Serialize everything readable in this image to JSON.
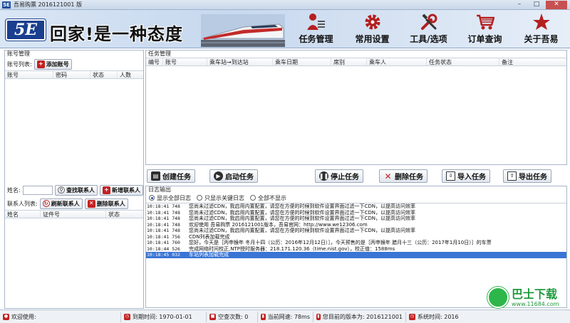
{
  "window": {
    "title": "吾易购票 2016121001 版",
    "app_icon": "5E"
  },
  "banner": {
    "logo": "5E",
    "slogan": "回家!是一种态度"
  },
  "toolbar": [
    {
      "label": "任务管理",
      "icon": "person-list-icon"
    },
    {
      "label": "常用设置",
      "icon": "gear-icon"
    },
    {
      "label": "工具/选项",
      "icon": "wrench-icon"
    },
    {
      "label": "订单查询",
      "icon": "cart-icon"
    },
    {
      "label": "关于吾易",
      "icon": "star-icon"
    }
  ],
  "account": {
    "group_title": "账号管理",
    "list_label": "账号列表:",
    "add_button": "添加账号",
    "columns": [
      "账号",
      "密码",
      "状态",
      "人数"
    ]
  },
  "contacts": {
    "name_label": "姓名:",
    "find_button": "查找联系人",
    "new_button": "新增联系人",
    "list_label": "联系人列表:",
    "refresh_button": "刷新联系人",
    "delete_button": "删除联系人",
    "columns": [
      "姓名",
      "证件号",
      "状态"
    ]
  },
  "tasks": {
    "group_title": "任务管理",
    "columns": [
      "编号",
      "账号",
      "乘车站→到达站",
      "乘车日期",
      "席别",
      "乘车人",
      "任务状态",
      "备注"
    ]
  },
  "actions": {
    "create": "创建任务",
    "start": "启动任务",
    "stop": "停止任务",
    "delete": "删除任务",
    "import": "导入任务",
    "export": "导出任务"
  },
  "log": {
    "group_title": "日志输出",
    "radio_all": "显示全部日志",
    "radio_key": "只显示关键日志",
    "radio_none": "全部不显示",
    "lines": [
      {
        "time": "10:18:41 748",
        "msg": "您尚未过滤CDN，我启用内置配置，请您在方便的时候到软件设置界面过滤一下CDN，以提高访问效率"
      },
      {
        "time": "10:18:41 748",
        "msg": "您尚未过滤CDN，我启用内置配置，请您在方便的时候到软件设置界面过滤一下CDN，以提高访问效率"
      },
      {
        "time": "10:18:41 748",
        "msg": "您尚未过滤CDN，我启用内置配置，请您在方便的时候到软件设置界面过滤一下CDN，以提高访问效率"
      },
      {
        "time": "10:18:41 748",
        "msg": "欢迎使用 吾易购票 2016121001版本，吾易官网：http://www.we12306.com"
      },
      {
        "time": "10:18:41 748",
        "msg": "您尚未过滤CDN，我启用内置配置，请您在方便的时候到软件设置界面过滤一下CDN，以提高访问效率"
      },
      {
        "time": "10:18:41 756",
        "msg": "CDN列表加载完成"
      },
      {
        "time": "10:18:41 760",
        "msg": "您好，今天是［丙申猴年 冬月十四（公历：2016年12月12日）］，今天预售的是［丙申猴年 腊月十三（公历：2017年1月10日）］的车票"
      },
      {
        "time": "10:18:44 526",
        "msg": "完成网络时间校正,NTP授时服务器：218.171.120.36（time.nist.gov），校正值：1588ms"
      },
      {
        "time": "10:18:45 032",
        "msg": "车站列表加载完成"
      }
    ]
  },
  "status": {
    "welcome": "欢迎使用:",
    "expire": "到期时间: 1970-01-01",
    "empty_count": "空查次数: 0",
    "speed": "当前网速: 78ms",
    "version": "您目前的版本为: 2016121001",
    "systime": "系统时间: 2016"
  },
  "watermark": {
    "big": "巴士下载",
    "small": "www.11684.com"
  }
}
